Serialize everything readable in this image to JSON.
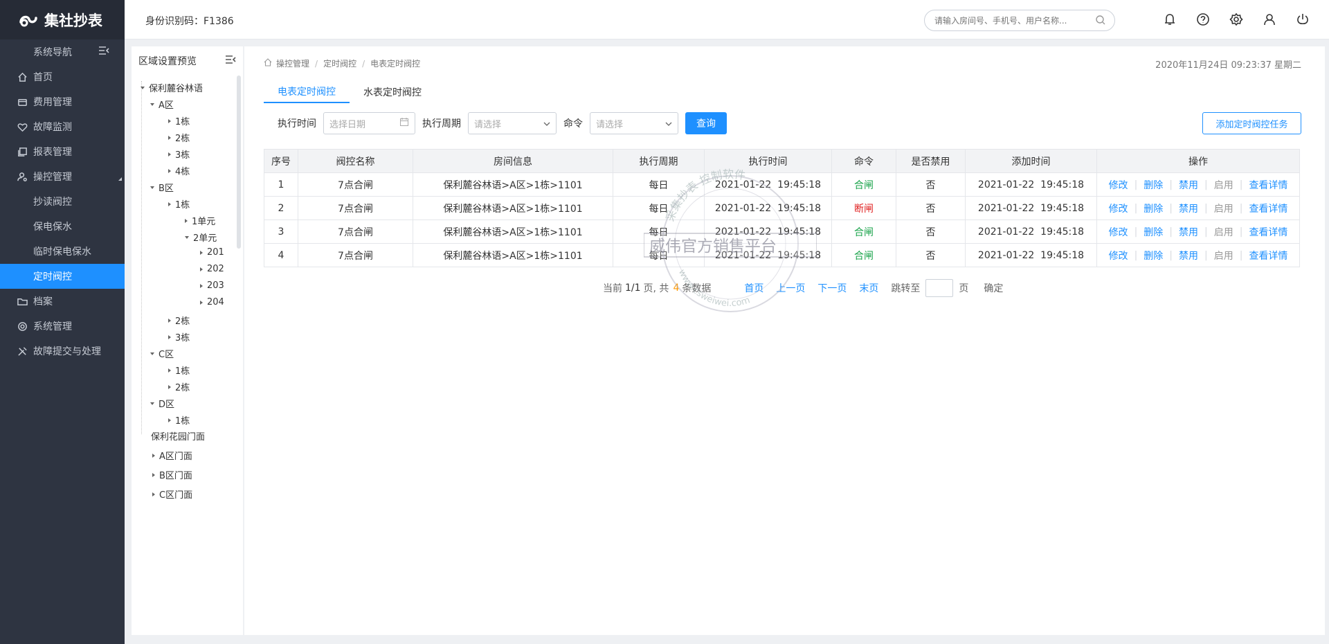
{
  "brand": {
    "name": "集社抄表"
  },
  "header": {
    "id_label": "身份识别码：F1386",
    "search_placeholder": "请输入房间号、手机号、用户名称..."
  },
  "sidebar": {
    "nav_title": "系统导航",
    "items": [
      {
        "label": "首页",
        "icon": "home-icon"
      },
      {
        "label": "费用管理",
        "icon": "wallet-icon"
      },
      {
        "label": "故障监测",
        "icon": "heart-icon"
      },
      {
        "label": "报表管理",
        "icon": "copy-icon"
      },
      {
        "label": "操控管理",
        "icon": "user-cog-icon"
      },
      {
        "label": "档案",
        "icon": "folder-icon"
      },
      {
        "label": "系统管理",
        "icon": "gear-icon"
      },
      {
        "label": "故障提交与处理",
        "icon": "tools-icon"
      }
    ],
    "subitems": [
      "抄读阀控",
      "保电保水",
      "临时保电保水",
      "定时阀控"
    ]
  },
  "tree": {
    "title": "区域设置预览",
    "nodes": [
      "保利麓谷林语",
      "A区",
      "1栋",
      "2栋",
      "3栋",
      "4栋",
      "B区",
      "1栋",
      "1单元",
      "2单元",
      "201",
      "202",
      "203",
      "204",
      "2栋",
      "3栋",
      "C区",
      "1栋",
      "2栋",
      "D区",
      "1栋",
      "保利花园门面",
      "A区门面",
      "B区门面",
      "C区门面"
    ]
  },
  "breadcrumb": [
    "操控管理",
    "定时阀控",
    "电表定时阀控"
  ],
  "datetime": "2020年11月24日 09:23:37 星期二",
  "tabs": [
    "电表定时阀控",
    "水表定时阀控"
  ],
  "filters": {
    "time_label": "执行时间",
    "time_placeholder": "选择日期",
    "cycle_label": "执行周期",
    "cycle_placeholder": "请选择",
    "cmd_label": "命令",
    "cmd_placeholder": "请选择",
    "query_button": "查询",
    "add_button": "添加定时阀控任务"
  },
  "table": {
    "headers": [
      "序号",
      "阀控名称",
      "房间信息",
      "执行周期",
      "执行时间",
      "命令",
      "是否禁用",
      "添加时间",
      "操作"
    ],
    "rows": [
      [
        "1",
        "7点合闸",
        "保利麓谷林语>A区>1栋>1101",
        "每日",
        "2021-01-22  19:45:18",
        "合闸",
        "否",
        "2021-01-22  19:45:18"
      ],
      [
        "2",
        "7点合闸",
        "保利麓谷林语>A区>1栋>1101",
        "每日",
        "2021-01-22  19:45:18",
        "断闸",
        "否",
        "2021-01-22  19:45:18"
      ],
      [
        "3",
        "7点合闸",
        "保利麓谷林语>A区>1栋>1101",
        "每日",
        "2021-01-22  19:45:18",
        "合闸",
        "否",
        "2021-01-22  19:45:18"
      ],
      [
        "4",
        "7点合闸",
        "保利麓谷林语>A区>1栋>1101",
        "每日",
        "2021-01-22  19:45:18",
        "合闸",
        "否",
        "2021-01-22  19:45:18"
      ]
    ],
    "ops": [
      "修改",
      "删除",
      "禁用",
      "启用",
      "查看详情"
    ]
  },
  "pager": {
    "prefix": "当前",
    "current": "1/1",
    "mid": "页, 共",
    "total": "4",
    "suffix": "条数据",
    "first": "首页",
    "prev": "上一页",
    "next": "下一页",
    "last": "末页",
    "jump_label": "跳转至",
    "page_unit": "页",
    "confirm": "确定"
  },
  "watermark": {
    "arc_text": "采集抄表 控制软件",
    "main_text": "威伟官方销售平台",
    "url": "www.csweiwei.com"
  },
  "colors": {
    "accent": "#1e90ff",
    "sidebar": "#2e3441",
    "on": "#19a34a",
    "off": "#e02020"
  }
}
